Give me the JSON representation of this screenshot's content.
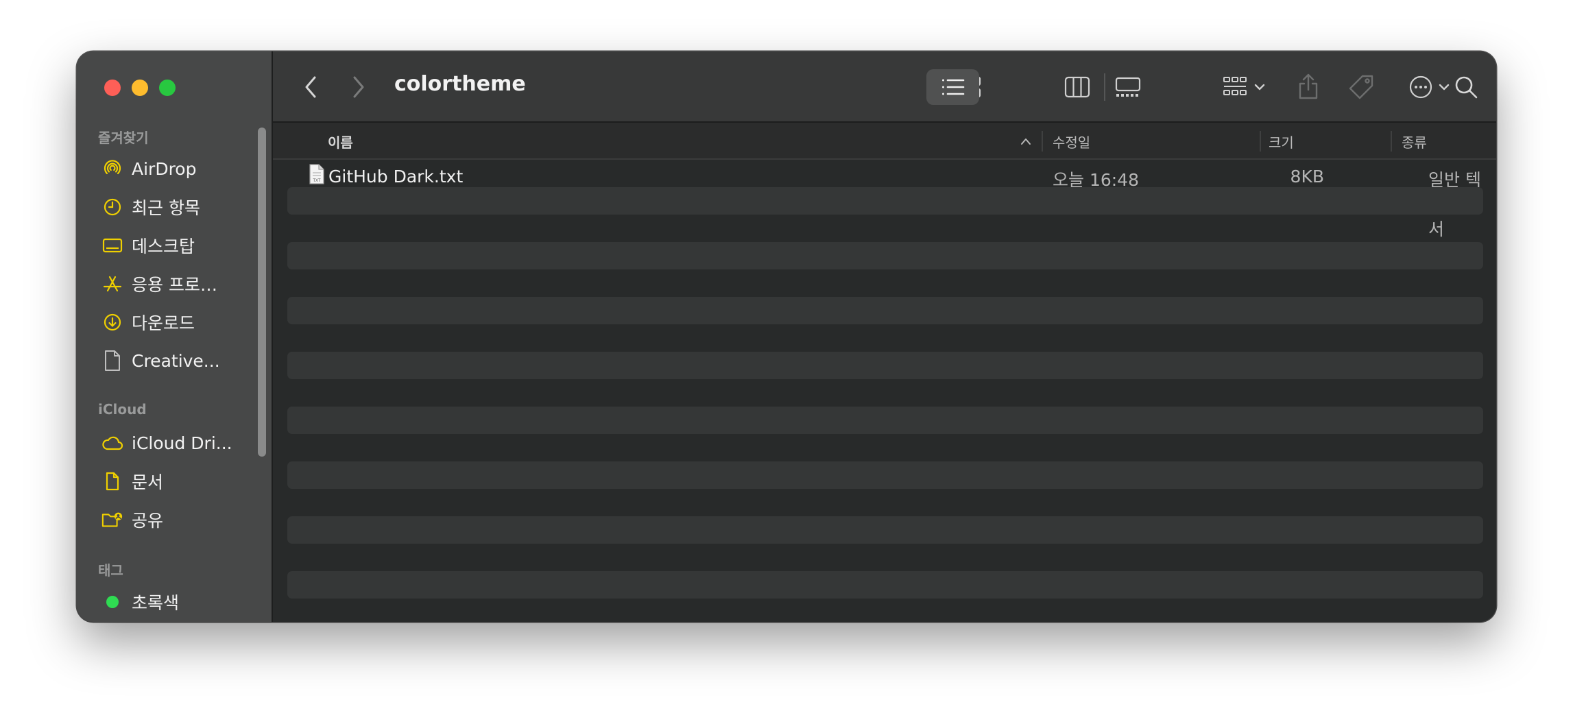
{
  "window": {
    "title": "colortheme"
  },
  "sidebar": {
    "sections": {
      "favorites": "즐겨찾기",
      "icloud": "iCloud",
      "tags": "태그"
    },
    "items": [
      {
        "label": "AirDrop",
        "icon": "airdrop-icon"
      },
      {
        "label": "최근 항목",
        "icon": "clock-icon"
      },
      {
        "label": "데스크탑",
        "icon": "desktop-icon"
      },
      {
        "label": "응용 프로…",
        "icon": "applications-icon"
      },
      {
        "label": "다운로드",
        "icon": "download-icon"
      },
      {
        "label": "Creative...",
        "icon": "document-icon"
      },
      {
        "label": "iCloud Dri...",
        "icon": "cloud-icon"
      },
      {
        "label": "문서",
        "icon": "document-icon"
      },
      {
        "label": "공유",
        "icon": "shared-folder-icon"
      },
      {
        "label": "초록색",
        "icon": "green-tag-icon"
      }
    ],
    "accent_color": "#f0d000",
    "tag_color": "#2fdb52"
  },
  "columns": {
    "name": "이름",
    "modified": "수정일",
    "size": "크기",
    "kind": "종류"
  },
  "files": [
    {
      "name": "GitHub Dark.txt",
      "modified": "오늘 16:48",
      "size": "8KB",
      "kind": "일반 텍스트 문서",
      "icon": "text-file-icon"
    }
  ]
}
